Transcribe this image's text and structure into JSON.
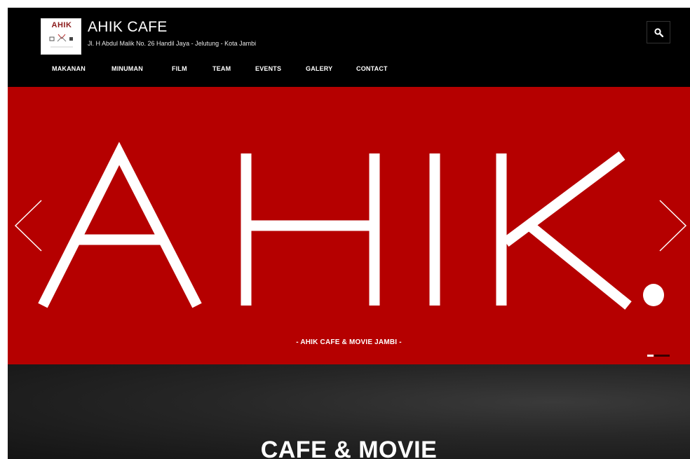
{
  "header": {
    "logo_text": "AHIK",
    "site_title": "AHIK CAFE",
    "site_address": "Jl. H Abdul Malik No. 26 Handil Jaya - Jelutung - Kota Jambi",
    "search_icon": "search-icon"
  },
  "nav": {
    "items": [
      {
        "label": "MAKANAN"
      },
      {
        "label": "MINUMAN"
      },
      {
        "label": "FILM"
      },
      {
        "label": "TEAM"
      },
      {
        "label": "EVENTS"
      },
      {
        "label": "GALERY"
      },
      {
        "label": "CONTACT"
      }
    ]
  },
  "hero": {
    "big_text": "AHIK.",
    "caption": "- AHIK CAFE & MOVIE JAMBI -",
    "prev_icon": "chevron-left-icon",
    "next_icon": "chevron-right-icon",
    "slide_count": 2,
    "active_slide": 1
  },
  "lower": {
    "title": "CAFE & MOVIE"
  },
  "colors": {
    "hero_red": "#b50000",
    "header_bg": "#000000",
    "text": "#ffffff",
    "logo_red": "#8b1a1a"
  }
}
